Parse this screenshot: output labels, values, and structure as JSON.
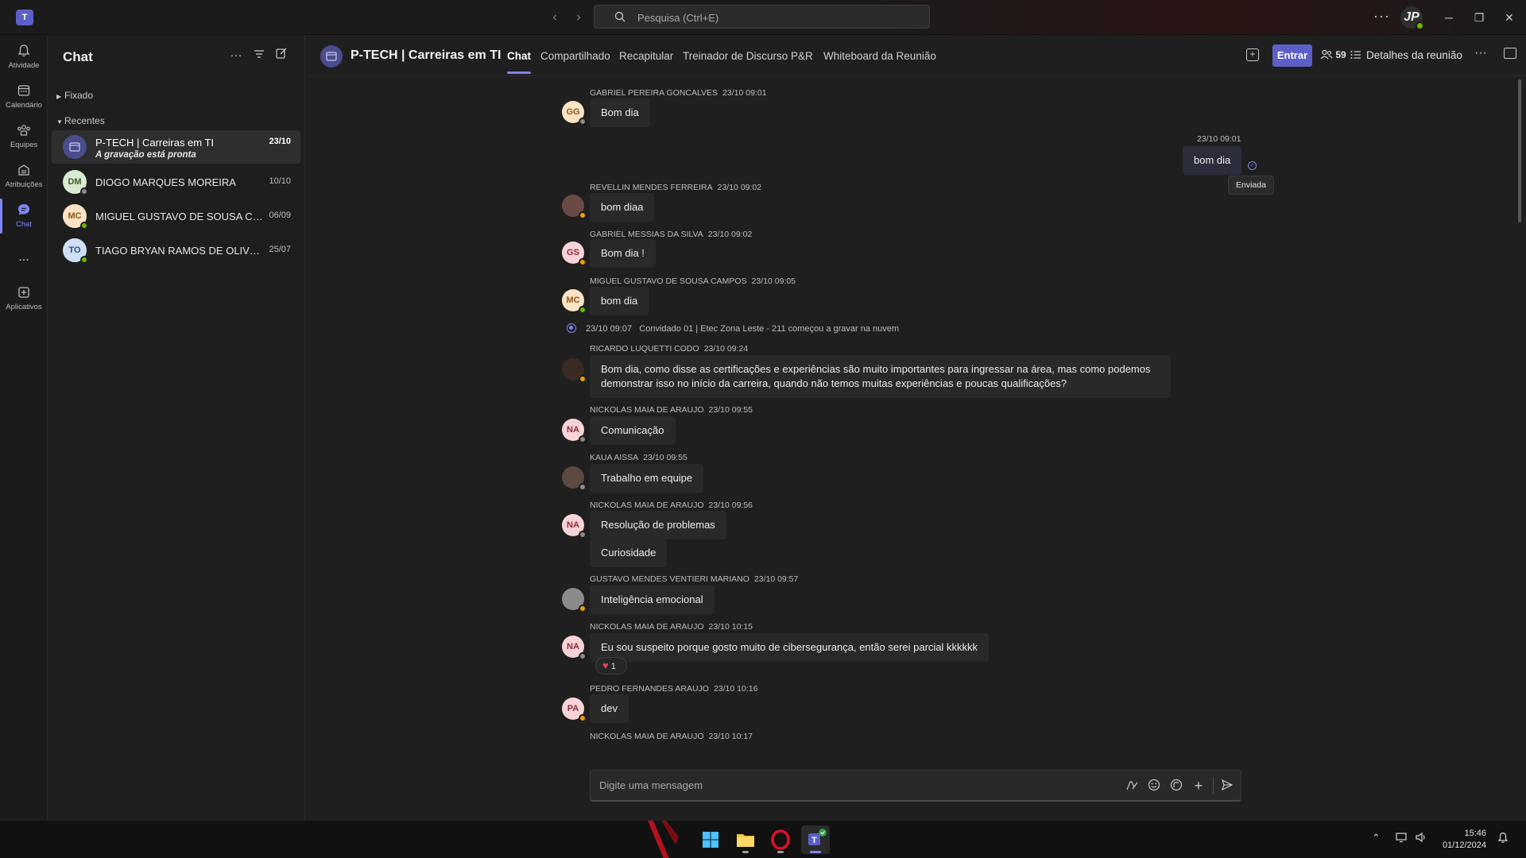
{
  "app": {
    "search_placeholder": "Pesquisa (Ctrl+E)",
    "user_initials": "JP"
  },
  "rail": [
    {
      "label": "Atividade",
      "icon": "bell-icon"
    },
    {
      "label": "Calendário",
      "icon": "calendar-icon"
    },
    {
      "label": "Equipes",
      "icon": "teams-icon"
    },
    {
      "label": "Atribuições",
      "icon": "assignments-icon"
    },
    {
      "label": "Chat",
      "icon": "chat-icon",
      "active": true
    },
    {
      "label": "...",
      "icon": "more-icon"
    },
    {
      "label": "Aplicativos",
      "icon": "apps-icon"
    }
  ],
  "chatlist": {
    "title": "Chat",
    "section_pinned": "Fixado",
    "section_recent": "Recentes",
    "items": [
      {
        "name": "P-TECH | Carreiras em TI",
        "subtitle": "A gravação está pronta",
        "date": "23/10",
        "initials": "",
        "selected": true
      },
      {
        "name": "DIOGO MARQUES MOREIRA",
        "date": "10/10",
        "initials": "DM"
      },
      {
        "name": "MIGUEL GUSTAVO DE SOUSA CAMP...",
        "date": "06/09",
        "initials": "MC"
      },
      {
        "name": "TIAGO BRYAN RAMOS DE OLIVEIRA",
        "date": "25/07",
        "initials": "TO"
      }
    ]
  },
  "header": {
    "title": "P-TECH | Carreiras em TI",
    "tabs": [
      "Chat",
      "Compartilhado",
      "Recapitular",
      "Treinador de Discurso",
      "P&R",
      "Whiteboard da Reunião"
    ],
    "join_label": "Entrar",
    "participants": "59",
    "details_label": "Detalhes da reunião"
  },
  "messages": [
    {
      "author": "GABRIEL PEREIRA GONCALVES",
      "time": "23/10 09:01",
      "initials": "GG",
      "text": "Bom dia"
    },
    {
      "mine": true,
      "time": "23/10 09:01",
      "text": "bom dia",
      "status": "Enviada"
    },
    {
      "author": "REVELLIN MENDES FERREIRA",
      "time": "23/10 09:02",
      "initials": "",
      "text": "bom diaa"
    },
    {
      "author": "GABRIEL MESSIAS DA SILVA",
      "time": "23/10 09:02",
      "initials": "GS",
      "text": "Bom dia !"
    },
    {
      "author": "MIGUEL GUSTAVO DE SOUSA CAMPOS",
      "time": "23/10 09:05",
      "initials": "MC",
      "text": "bom dia"
    },
    {
      "system": true,
      "time": "23/10 09:07",
      "text": "Convidado 01 | Etec Zona Leste - 211 começou a gravar na nuvem"
    },
    {
      "author": "RICARDO LUQUETTI CODO",
      "time": "23/10 09:24",
      "initials": "",
      "text": "Bom dia, como disse as certificações e experiências são muito importantes para ingressar na área, mas como podemos demonstrar isso no início da carreira, quando não temos muitas experiências e poucas qualificações?"
    },
    {
      "author": "NICKOLAS MAIA DE ARAUJO",
      "time": "23/10 09:55",
      "initials": "NA",
      "text": "Comunicação"
    },
    {
      "author": "KAUA AISSA",
      "time": "23/10 09:55",
      "initials": "",
      "text": "Trabalho em equipe"
    },
    {
      "author": "NICKOLAS MAIA DE ARAUJO",
      "time": "23/10 09:56",
      "initials": "NA",
      "text": "Resolução de problemas",
      "text2": "Curiosidade"
    },
    {
      "author": "GUSTAVO MENDES VENTIERI MARIANO",
      "time": "23/10 09:57",
      "initials": "",
      "text": "Inteligência emocional"
    },
    {
      "author": "NICKOLAS MAIA DE ARAUJO",
      "time": "23/10 10:15",
      "initials": "NA",
      "text": "Eu sou suspeito porque gosto muito de cibersegurança, então serei parcial kkkkkk",
      "reaction_count": "1"
    },
    {
      "author": "PEDRO FERNANDES ARAUJO",
      "time": "23/10 10:16",
      "initials": "PA",
      "text": "dev"
    },
    {
      "author": "NICKOLAS MAIA DE ARAUJO",
      "time": "23/10 10:17",
      "initials": "NA"
    }
  ],
  "composer": {
    "placeholder": "Digite uma mensagem"
  },
  "taskbar": {
    "time": "15:46",
    "date": "01/12/2024"
  }
}
